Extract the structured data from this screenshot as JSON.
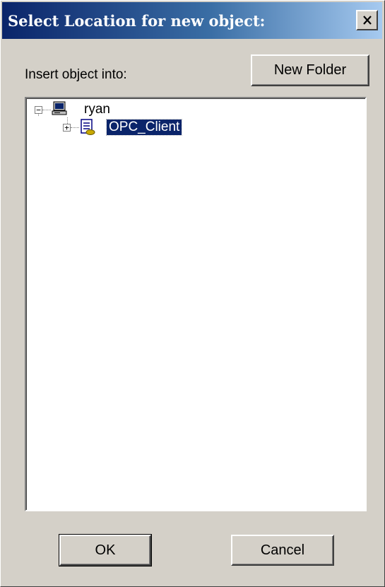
{
  "window": {
    "title": "Select Location for new object:",
    "close_glyph": "✕"
  },
  "toolbar": {
    "new_folder_label": "New Folder"
  },
  "insert_label": "Insert object into:",
  "tree": {
    "nodes": [
      {
        "label": "ryan",
        "icon": "computer-icon",
        "expander": "−",
        "selected": false
      },
      {
        "label": "OPC_Client",
        "icon": "document-icon",
        "expander": "+",
        "selected": true
      }
    ]
  },
  "footer": {
    "ok_label": "OK",
    "cancel_label": "Cancel"
  },
  "colors": {
    "titlebar_start": "#0a246a",
    "titlebar_end": "#a6caf0",
    "dialog_face": "#d4d0c8",
    "selection": "#0a246a"
  }
}
